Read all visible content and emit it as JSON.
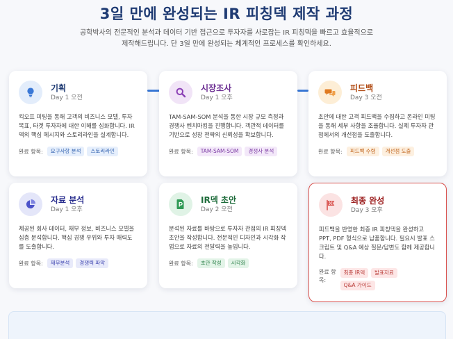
{
  "header": {
    "title": "3일 만에 완성되는 IR 피칭덱 제작 과정",
    "subtitle_line1": "공학박사의 전문적인 분석과 데이터 기반 접근으로 투자자를 사로잡는 IR 피칭덱을 빠르고 효율적으로",
    "subtitle_line2": "제작해드립니다. 단 3일 만에 완성되는 체계적인 프로세스를 확인하세요."
  },
  "done_label": "완료 항목:",
  "done_label_final_1": "완료 항",
  "done_label_final_2": "목:",
  "cards": [
    {
      "title": "기획",
      "day": "Day 1 오전",
      "desc": "킥오프 미팅을 통해 고객의 비즈니스 모델, 투자 목표, 타겟 투자자에 대한 이해를 심화합니다. IR덱의 핵심 메시지와 스토리라인을 설계합니다.",
      "tags": [
        "요구사항 분석",
        "스토리라인"
      ],
      "icon": "lightbulb-icon",
      "color": "#1f3b73",
      "icon_bg": "#e3edfb",
      "icon_color": "#3a78d6",
      "tag_bg": "#e6effc",
      "tag_color": "#2f5fae"
    },
    {
      "title": "시장조사",
      "day": "Day 1 오후",
      "desc": "TAM-SAM-SOM 분석을 통한 시장 규모 측정과 경쟁사 벤치마킹을 진행합니다. 객관적 데이터를 기반으로 성장 전략의 신뢰성을 확보합니다.",
      "tags": [
        "TAM-SAM-SOM",
        "경쟁사 분석"
      ],
      "icon": "magnifier-icon",
      "color": "#6a2c91",
      "icon_bg": "#f1e4f7",
      "icon_color": "#8a3fb5",
      "tag_bg": "#f3e8f9",
      "tag_color": "#7b3aa3"
    },
    {
      "title": "피드백",
      "day": "Day 3 오전",
      "desc": "초안에 대한 고객 피드백을 수집하고 온라인 미팅을 통해 세부 사항을 조율합니다. 실제 투자자 관점에서의 개선점을 도출합니다.",
      "tags": [
        "피드백 수렴",
        "개선점 도출"
      ],
      "icon": "chat-bubbles-icon",
      "color": "#b04a12",
      "icon_bg": "#fdeed6",
      "icon_color": "#e07a1f",
      "tag_bg": "#fdf0e0",
      "tag_color": "#c0621a"
    },
    {
      "title": "자료 분석",
      "day": "Day 1 오후",
      "desc": "제공된 회사 데이터, 재무 정보, 비즈니스 모델을 심층 분석합니다. 핵심 경쟁 우위와 투자 매력도를 도출합니다.",
      "tags": [
        "재무분석",
        "경쟁력 파악"
      ],
      "icon": "pie-chart-icon",
      "color": "#2a2f8f",
      "icon_bg": "#e4e6f9",
      "icon_color": "#4b52c9",
      "tag_bg": "#e8eafa",
      "tag_color": "#3e45b0"
    },
    {
      "title": "IR덱 초안",
      "day": "Day 2 오전",
      "desc": "분석된 자료를 바탕으로 투자자 관점의 IR 피칭덱 초안을 작성합니다. 전문적인 디자인과 시각화 작업으로 자료의 전달력을 높입니다.",
      "tags": [
        "초안 작성",
        "시각화"
      ],
      "icon": "document-icon",
      "color": "#1d6b3a",
      "icon_bg": "#e0f3e6",
      "icon_color": "#2f9a55",
      "tag_bg": "#e3f4e8",
      "tag_color": "#2a7f47"
    },
    {
      "title": "최종 완성",
      "day": "Day 3 오후",
      "desc": "피드백을 반영한 최종 IR 피칭덱을 완성하고 PPT, PDF 형식으로 납품합니다. 필요시 발표 스크립트 및 Q&A 예상 질문/답변도 함께 제공합니다.",
      "tags": [
        "최종 IR덱",
        "발표자료",
        "Q&A 가이드"
      ],
      "icon": "flag-icon",
      "color": "#9b1c1c",
      "icon_bg": "#fbe3e3",
      "icon_color": "#d9534f",
      "tag_bg": "#fde6e6",
      "tag_color": "#b83a36"
    }
  ]
}
